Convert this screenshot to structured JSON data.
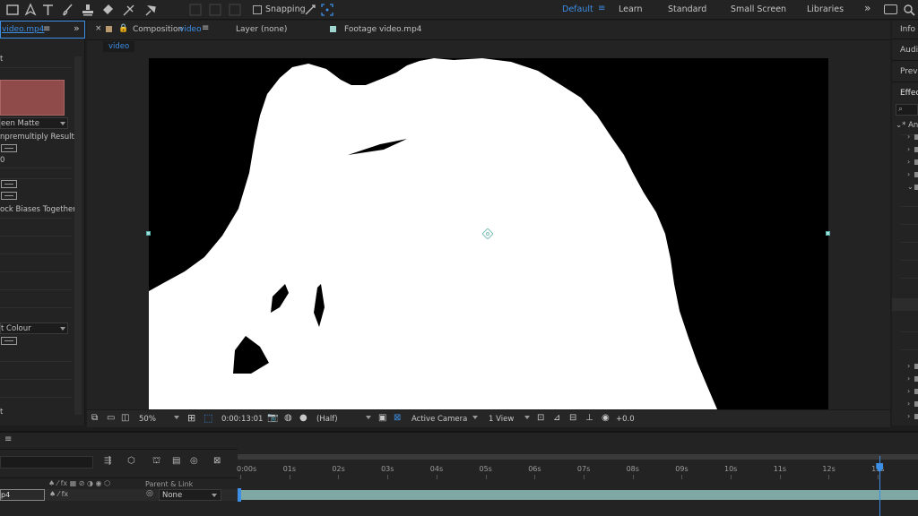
{
  "toolbar": {
    "snapping_label": "Snapping",
    "workspaces": [
      "Default",
      "Learn",
      "Standard",
      "Small Screen",
      "Libraries"
    ],
    "active_workspace": "Default",
    "more_glyph": "»"
  },
  "effect_controls": {
    "tab_title": "video.mp4",
    "header_item": "t",
    "view_dropdown_value": "een Matte",
    "unpremultiply_label": "npremultiply Result",
    "small_value": "0",
    "lock_biases_label": "ock Biases Together",
    "colour_dropdown_value": "t Colour",
    "footer_item": "t"
  },
  "viewer": {
    "tabs": [
      {
        "prefix": "Composition",
        "name": "video",
        "active": true
      },
      {
        "label": "Layer (none)",
        "active": false
      },
      {
        "label": "Footage video.mp4",
        "active": false
      }
    ],
    "breadcrumb": "video",
    "zoom": "50%",
    "timecode": "0:00:13:01",
    "resolution": "(Half)",
    "camera": "Active Camera",
    "views": "1 View",
    "exposure": "+0.0"
  },
  "right_panel": {
    "items": [
      "Info",
      "Audio",
      "Previ",
      "Effec"
    ],
    "search_placeholder": "",
    "tree_label": "An"
  },
  "timeline": {
    "ruler": [
      "0:00s",
      "01s",
      "02s",
      "03s",
      "04s",
      "05s",
      "06s",
      "07s",
      "08s",
      "09s",
      "10s",
      "11s",
      "12s",
      "13s"
    ],
    "column_header": "Parent & Link",
    "layer_name_fragment": "p4",
    "parent_value": "None",
    "playhead_seconds": 13.04
  },
  "colors": {
    "accent": "#3d8ee5",
    "panel_bg": "#232323",
    "app_bg": "#1d1d1d",
    "layer_bar": "#7fa7a3",
    "swatch": "#8f4a4a"
  }
}
